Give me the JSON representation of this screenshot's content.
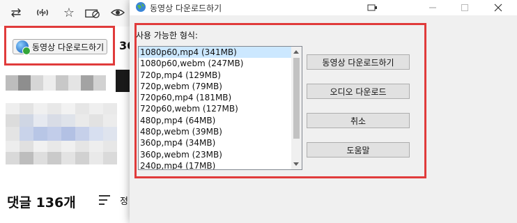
{
  "browser": {
    "toolbar_icons": [
      "repeat-icon",
      "no-signal-icon",
      "star-icon",
      "adblock-icon",
      "eye-off-icon"
    ],
    "extension_button_label": "동영상 다운로드하기",
    "side_text": "36",
    "comments_label": "댓글 136개",
    "sort_label": "정"
  },
  "dialog": {
    "title": "동영상 다운로드하기",
    "formats_label": "사용 가능한 형식:",
    "formats": [
      "1080p60,mp4 (341MB)",
      "1080p60,webm (247MB)",
      "720p,mp4 (129MB)",
      "720p,webm (79MB)",
      "720p60,mp4 (181MB)",
      "720p60,webm (127MB)",
      "480p,mp4 (64MB)",
      "480p,webm (39MB)",
      "360p,mp4 (34MB)",
      "360p,webm (23MB)",
      "240p,mp4 (17MB)"
    ],
    "selected_index": 0,
    "buttons": {
      "download_video": "동영상 다운로드하기",
      "download_audio": "오디오 다운로드",
      "cancel": "취소",
      "help": "도움말"
    },
    "window_controls": [
      "restore-icon",
      "minimize-icon",
      "maximize-icon",
      "close-icon"
    ]
  },
  "colors": {
    "highlight_frame": "#e03b3b",
    "selection": "#cce8ff",
    "dialog_bg": "#f0f0f0"
  }
}
